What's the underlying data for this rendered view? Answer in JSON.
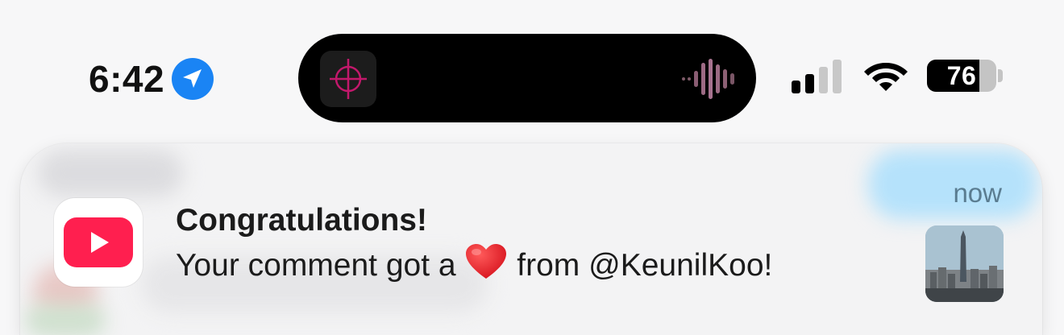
{
  "status_bar": {
    "time": "6:42",
    "location_icon": "location-arrow-icon",
    "signal_icon": "cellular-signal-icon",
    "wifi_icon": "wifi-icon",
    "battery_level": 76,
    "battery_label": "76"
  },
  "dynamic_island": {
    "app_icon": "crosshair-app-icon",
    "activity_icon": "audio-waveform-icon"
  },
  "notification": {
    "app_icon": "youtube-icon",
    "title": "Congratulations!",
    "body_prefix": "Your comment got a",
    "body_emoji": "heart-emoji",
    "body_suffix": "from @KeunilKoo!",
    "time": "now",
    "thumbnail": "city-skyline-thumbnail",
    "colors": {
      "youtube_red": "#ff1f4f",
      "time_label": "#5a7c90"
    }
  }
}
